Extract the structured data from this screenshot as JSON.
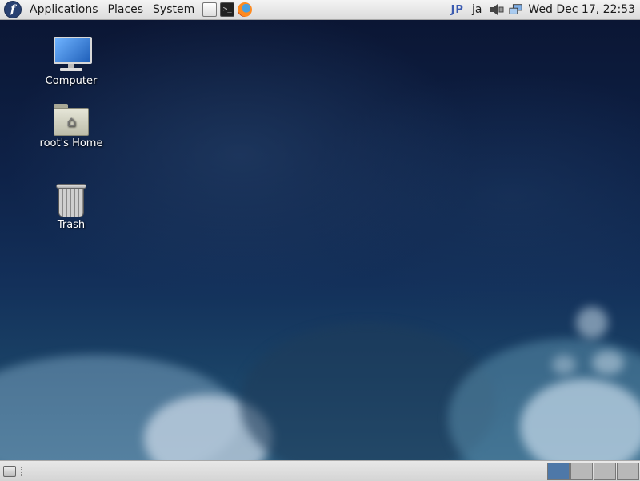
{
  "top_panel": {
    "menus": [
      "Applications",
      "Places",
      "System"
    ],
    "launchers": [
      "notes-launcher-icon",
      "terminal-launcher-icon",
      "firefox-launcher-icon"
    ],
    "tray": {
      "keyboard_layout": "JP",
      "input_method": "ja",
      "icons": [
        "volume-icon",
        "network-icon"
      ]
    },
    "clock": "Wed Dec 17, 22:53"
  },
  "desktop": {
    "icons": [
      {
        "label": "Computer",
        "icon": "computer-icon"
      },
      {
        "label": "root's Home",
        "icon": "home-folder-icon"
      },
      {
        "label": "Trash",
        "icon": "trash-icon"
      }
    ]
  },
  "bottom_panel": {
    "workspaces": 4,
    "active_workspace": 1
  },
  "colors": {
    "panel_bg": "#dcdcdc",
    "wallpaper_top": "#0b1634",
    "wallpaper_bottom": "#2a5a7c",
    "active_workspace": "#4e78a8"
  }
}
